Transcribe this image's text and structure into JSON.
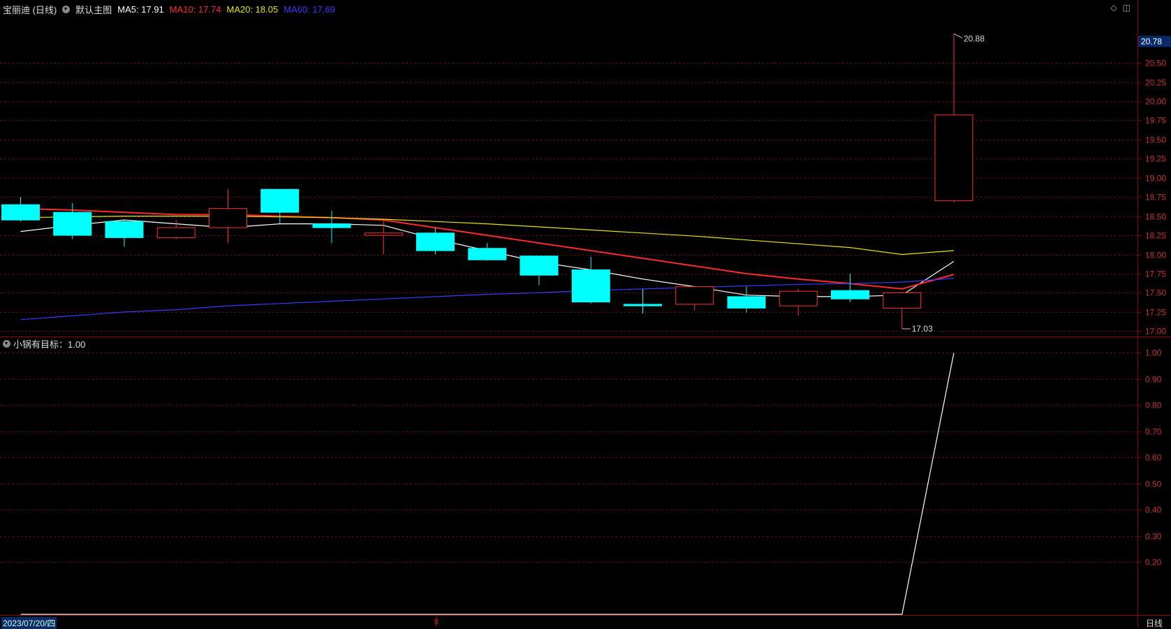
{
  "header": {
    "stock_name": "宝丽迪 (日线)",
    "template": "默认主图",
    "ma5": "MA5: 17.91",
    "ma10": "MA10: 17.74",
    "ma20": "MA20: 18.05",
    "ma60": "MA60: 17.69",
    "colors": {
      "ma5": "#ffffff",
      "ma10": "#ff2a2a",
      "ma20": "#e6e600",
      "ma60": "#3a3aff"
    }
  },
  "indicator": {
    "label": "小锅有目标：1.00"
  },
  "footer": {
    "date": "2023/07/20/四",
    "month_marker": "8",
    "period": "日线"
  },
  "price_panel": {
    "current_price_tag": "20.78",
    "high_label": "20.88",
    "low_label": "17.03",
    "y_ticks": [
      "20.50",
      "20.25",
      "20.00",
      "19.75",
      "19.50",
      "19.25",
      "19.00",
      "18.75",
      "18.50",
      "18.25",
      "18.00",
      "17.75",
      "17.50",
      "17.25",
      "17.00"
    ]
  },
  "indicator_panel": {
    "y_ticks": [
      "1.00",
      "0.90",
      "0.80",
      "0.70",
      "0.60",
      "0.50",
      "0.40",
      "0.30",
      "0.20"
    ]
  },
  "chart_data": [
    {
      "type": "candlestick",
      "ylim": [
        16.93,
        21.12
      ],
      "candles": [
        {
          "o": 18.65,
          "c": 18.45,
          "h": 18.75,
          "l": 18.43
        },
        {
          "o": 18.55,
          "c": 18.25,
          "h": 18.67,
          "l": 18.2
        },
        {
          "o": 18.43,
          "c": 18.22,
          "h": 18.45,
          "l": 18.1
        },
        {
          "o": 18.22,
          "c": 18.35,
          "h": 18.45,
          "l": 18.2
        },
        {
          "o": 18.35,
          "c": 18.6,
          "h": 18.85,
          "l": 18.15
        },
        {
          "o": 18.85,
          "c": 18.55,
          "h": 18.85,
          "l": 18.4
        },
        {
          "o": 18.4,
          "c": 18.35,
          "h": 18.57,
          "l": 18.15
        },
        {
          "o": 18.25,
          "c": 18.28,
          "h": 18.45,
          "l": 18.0
        },
        {
          "o": 18.28,
          "c": 18.05,
          "h": 18.35,
          "l": 18.0
        },
        {
          "o": 18.08,
          "c": 17.93,
          "h": 18.15,
          "l": 17.92
        },
        {
          "o": 17.98,
          "c": 17.73,
          "h": 17.98,
          "l": 17.6
        },
        {
          "o": 17.8,
          "c": 17.38,
          "h": 17.97,
          "l": 17.36
        },
        {
          "o": 17.35,
          "c": 17.33,
          "h": 17.55,
          "l": 17.23
        },
        {
          "o": 17.35,
          "c": 17.58,
          "h": 17.58,
          "l": 17.27
        },
        {
          "o": 17.45,
          "c": 17.3,
          "h": 17.58,
          "l": 17.24
        },
        {
          "o": 17.33,
          "c": 17.52,
          "h": 17.55,
          "l": 17.2
        },
        {
          "o": 17.53,
          "c": 17.42,
          "h": 17.75,
          "l": 17.38
        },
        {
          "o": 17.3,
          "c": 17.5,
          "h": 17.5,
          "l": 17.03
        },
        {
          "o": 18.7,
          "c": 19.82,
          "h": 20.88,
          "l": 18.68
        }
      ],
      "series": [
        {
          "name": "MA5",
          "values": [
            18.3,
            18.38,
            18.45,
            18.4,
            18.35,
            18.4,
            18.4,
            18.38,
            18.2,
            18.05,
            17.9,
            17.8,
            17.68,
            17.58,
            17.47,
            17.45,
            17.45,
            17.47,
            17.91
          ]
        },
        {
          "name": "MA10",
          "values": [
            18.6,
            18.58,
            18.55,
            18.52,
            18.52,
            18.5,
            18.48,
            18.45,
            18.35,
            18.25,
            18.15,
            18.05,
            17.95,
            17.85,
            17.75,
            17.68,
            17.62,
            17.55,
            17.74
          ]
        },
        {
          "name": "MA20",
          "values": [
            18.48,
            18.49,
            18.5,
            18.5,
            18.5,
            18.49,
            18.48,
            18.46,
            18.43,
            18.4,
            18.36,
            18.32,
            18.28,
            18.24,
            18.19,
            18.14,
            18.09,
            18.0,
            18.05
          ]
        },
        {
          "name": "MA60",
          "values": [
            17.15,
            17.2,
            17.25,
            17.28,
            17.33,
            17.36,
            17.39,
            17.42,
            17.45,
            17.48,
            17.5,
            17.53,
            17.55,
            17.57,
            17.59,
            17.61,
            17.62,
            17.64,
            17.69
          ]
        }
      ]
    },
    {
      "type": "line",
      "ylim": [
        0.0,
        1.06
      ],
      "series": [
        {
          "name": "小锅有目标",
          "values": [
            0,
            0,
            0,
            0,
            0,
            0,
            0,
            0,
            0,
            0,
            0,
            0,
            0,
            0,
            0,
            0,
            0,
            0,
            1.0
          ]
        }
      ]
    }
  ]
}
